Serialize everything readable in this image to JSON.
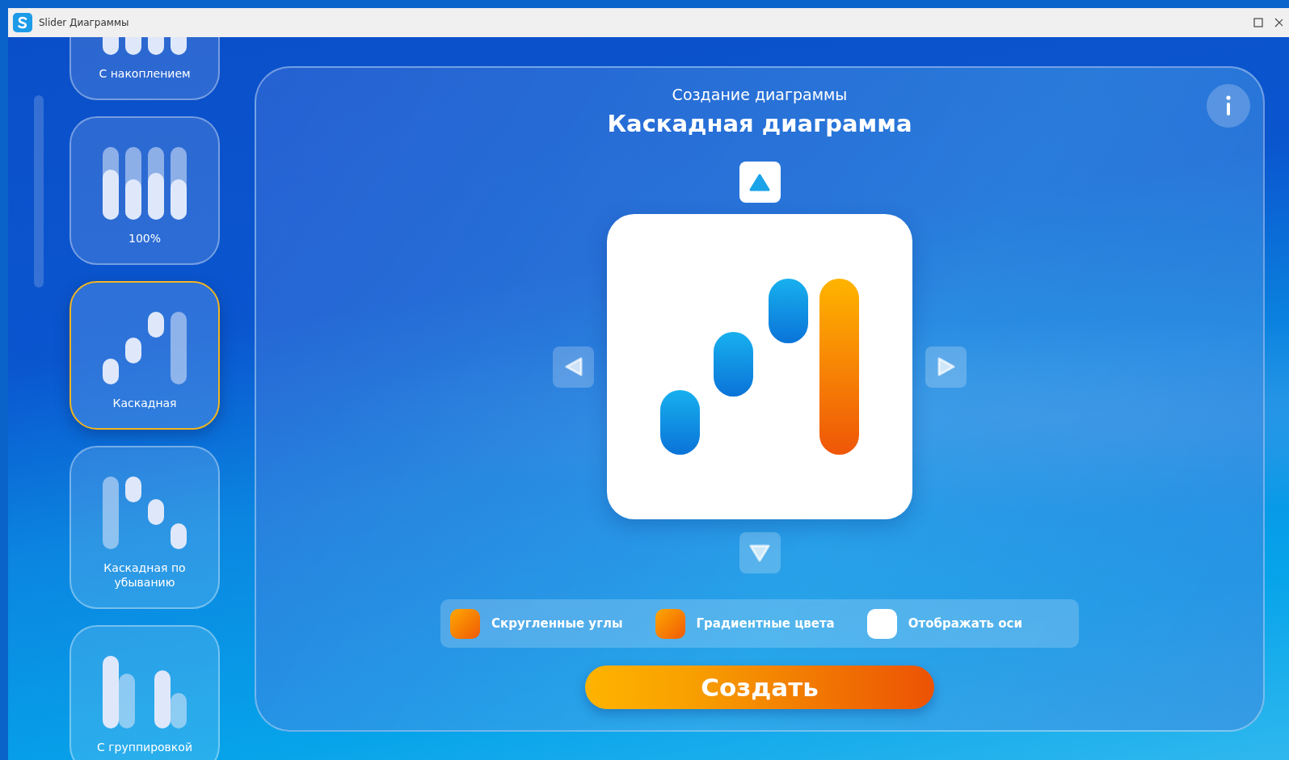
{
  "window": {
    "title": "Slider Диаграммы"
  },
  "sidebar": {
    "items": [
      {
        "kind": "stacked",
        "label": "С накоплением",
        "selected": false
      },
      {
        "kind": "percent",
        "label": "100%",
        "selected": false
      },
      {
        "kind": "cascade",
        "label": "Каскадная",
        "selected": true
      },
      {
        "kind": "cascade-desc",
        "label": "Каскадная по убыванию",
        "selected": false
      },
      {
        "kind": "grouped",
        "label": "С группировкой",
        "selected": false
      }
    ]
  },
  "main": {
    "subtitle": "Создание диаграммы",
    "title": "Каскадная диаграмма",
    "options": [
      {
        "label": "Скругленные углы",
        "checked": true
      },
      {
        "label": "Градиентные цвета",
        "checked": true
      },
      {
        "label": "Отображать оси",
        "checked": false
      }
    ],
    "create_button": "Создать"
  }
}
